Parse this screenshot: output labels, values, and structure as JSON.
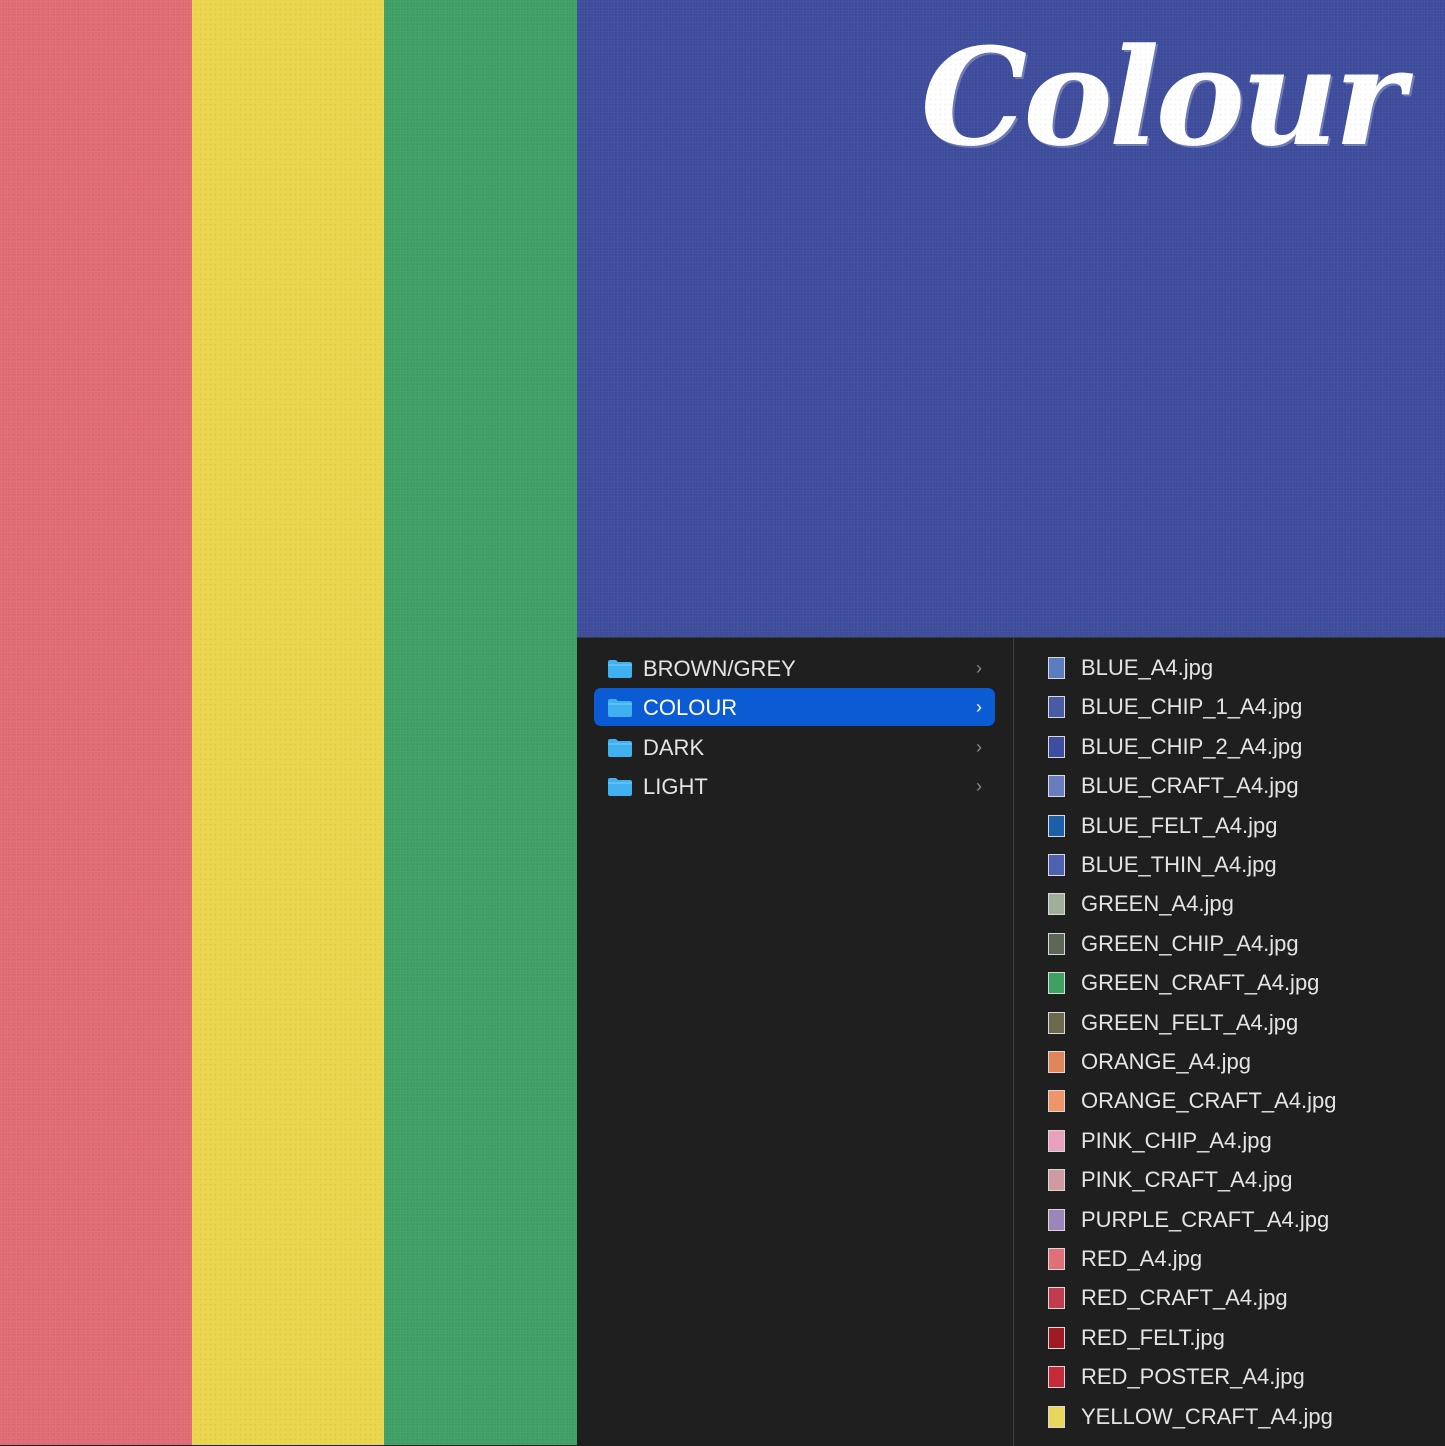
{
  "colors": {
    "red": "#e06b74",
    "yellow": "#ead54b",
    "green": "#3fa064",
    "blue": "#3d4c9c",
    "finder_bg": "#1f1f1f",
    "selection": "#0a5bd4",
    "folder_icon": "#3fb1f1"
  },
  "title": "Colour",
  "folders": [
    {
      "label": "BROWN/GREY",
      "icon": "folder-icon",
      "selected": false
    },
    {
      "label": "COLOUR",
      "icon": "folder-icon",
      "selected": true
    },
    {
      "label": "DARK",
      "icon": "folder-icon",
      "selected": false
    },
    {
      "label": "LIGHT",
      "icon": "folder-icon",
      "selected": false
    }
  ],
  "chevron": "›",
  "files": [
    {
      "name": "BLUE_A4.jpg",
      "swatch": "#5b7cbe"
    },
    {
      "name": "BLUE_CHIP_1_A4.jpg",
      "swatch": "#4a5ba6"
    },
    {
      "name": "BLUE_CHIP_2_A4.jpg",
      "swatch": "#3d4ea0"
    },
    {
      "name": "BLUE_CRAFT_A4.jpg",
      "swatch": "#6a7cc0"
    },
    {
      "name": "BLUE_FELT_A4.jpg",
      "swatch": "#1a5fa8"
    },
    {
      "name": "BLUE_THIN_A4.jpg",
      "swatch": "#4e60b0"
    },
    {
      "name": "GREEN_A4.jpg",
      "swatch": "#9fb09a"
    },
    {
      "name": "GREEN_CHIP_A4.jpg",
      "swatch": "#5e6658"
    },
    {
      "name": "GREEN_CRAFT_A4.jpg",
      "swatch": "#3fa064"
    },
    {
      "name": "GREEN_FELT_A4.jpg",
      "swatch": "#6b6a4e"
    },
    {
      "name": "ORANGE_A4.jpg",
      "swatch": "#e0855a"
    },
    {
      "name": "ORANGE_CRAFT_A4.jpg",
      "swatch": "#f0956a"
    },
    {
      "name": "PINK_CHIP_A4.jpg",
      "swatch": "#e8a0bc"
    },
    {
      "name": "PINK_CRAFT_A4.jpg",
      "swatch": "#d09aa2"
    },
    {
      "name": "PURPLE_CRAFT_A4.jpg",
      "swatch": "#9a86b8"
    },
    {
      "name": "RED_A4.jpg",
      "swatch": "#e07078"
    },
    {
      "name": "RED_CRAFT_A4.jpg",
      "swatch": "#c03c4e"
    },
    {
      "name": "RED_FELT.jpg",
      "swatch": "#9e1b24"
    },
    {
      "name": "RED_POSTER_A4.jpg",
      "swatch": "#c42a3a"
    },
    {
      "name": "YELLOW_CRAFT_A4.jpg",
      "swatch": "#ead65a"
    }
  ]
}
